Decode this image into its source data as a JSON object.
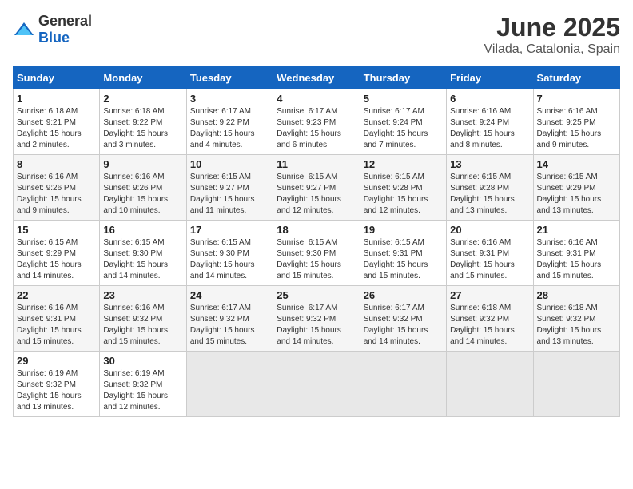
{
  "logo": {
    "general": "General",
    "blue": "Blue"
  },
  "title": "June 2025",
  "subtitle": "Vilada, Catalonia, Spain",
  "days_of_week": [
    "Sunday",
    "Monday",
    "Tuesday",
    "Wednesday",
    "Thursday",
    "Friday",
    "Saturday"
  ],
  "weeks": [
    [
      {
        "day": "1",
        "sunrise": "6:18 AM",
        "sunset": "9:21 PM",
        "daylight": "15 hours and 2 minutes."
      },
      {
        "day": "2",
        "sunrise": "6:18 AM",
        "sunset": "9:22 PM",
        "daylight": "15 hours and 3 minutes."
      },
      {
        "day": "3",
        "sunrise": "6:17 AM",
        "sunset": "9:22 PM",
        "daylight": "15 hours and 4 minutes."
      },
      {
        "day": "4",
        "sunrise": "6:17 AM",
        "sunset": "9:23 PM",
        "daylight": "15 hours and 6 minutes."
      },
      {
        "day": "5",
        "sunrise": "6:17 AM",
        "sunset": "9:24 PM",
        "daylight": "15 hours and 7 minutes."
      },
      {
        "day": "6",
        "sunrise": "6:16 AM",
        "sunset": "9:24 PM",
        "daylight": "15 hours and 8 minutes."
      },
      {
        "day": "7",
        "sunrise": "6:16 AM",
        "sunset": "9:25 PM",
        "daylight": "15 hours and 9 minutes."
      }
    ],
    [
      {
        "day": "8",
        "sunrise": "6:16 AM",
        "sunset": "9:26 PM",
        "daylight": "15 hours and 9 minutes."
      },
      {
        "day": "9",
        "sunrise": "6:16 AM",
        "sunset": "9:26 PM",
        "daylight": "15 hours and 10 minutes."
      },
      {
        "day": "10",
        "sunrise": "6:15 AM",
        "sunset": "9:27 PM",
        "daylight": "15 hours and 11 minutes."
      },
      {
        "day": "11",
        "sunrise": "6:15 AM",
        "sunset": "9:27 PM",
        "daylight": "15 hours and 12 minutes."
      },
      {
        "day": "12",
        "sunrise": "6:15 AM",
        "sunset": "9:28 PM",
        "daylight": "15 hours and 12 minutes."
      },
      {
        "day": "13",
        "sunrise": "6:15 AM",
        "sunset": "9:28 PM",
        "daylight": "15 hours and 13 minutes."
      },
      {
        "day": "14",
        "sunrise": "6:15 AM",
        "sunset": "9:29 PM",
        "daylight": "15 hours and 13 minutes."
      }
    ],
    [
      {
        "day": "15",
        "sunrise": "6:15 AM",
        "sunset": "9:29 PM",
        "daylight": "15 hours and 14 minutes."
      },
      {
        "day": "16",
        "sunrise": "6:15 AM",
        "sunset": "9:30 PM",
        "daylight": "15 hours and 14 minutes."
      },
      {
        "day": "17",
        "sunrise": "6:15 AM",
        "sunset": "9:30 PM",
        "daylight": "15 hours and 14 minutes."
      },
      {
        "day": "18",
        "sunrise": "6:15 AM",
        "sunset": "9:30 PM",
        "daylight": "15 hours and 15 minutes."
      },
      {
        "day": "19",
        "sunrise": "6:15 AM",
        "sunset": "9:31 PM",
        "daylight": "15 hours and 15 minutes."
      },
      {
        "day": "20",
        "sunrise": "6:16 AM",
        "sunset": "9:31 PM",
        "daylight": "15 hours and 15 minutes."
      },
      {
        "day": "21",
        "sunrise": "6:16 AM",
        "sunset": "9:31 PM",
        "daylight": "15 hours and 15 minutes."
      }
    ],
    [
      {
        "day": "22",
        "sunrise": "6:16 AM",
        "sunset": "9:31 PM",
        "daylight": "15 hours and 15 minutes."
      },
      {
        "day": "23",
        "sunrise": "6:16 AM",
        "sunset": "9:32 PM",
        "daylight": "15 hours and 15 minutes."
      },
      {
        "day": "24",
        "sunrise": "6:17 AM",
        "sunset": "9:32 PM",
        "daylight": "15 hours and 15 minutes."
      },
      {
        "day": "25",
        "sunrise": "6:17 AM",
        "sunset": "9:32 PM",
        "daylight": "15 hours and 14 minutes."
      },
      {
        "day": "26",
        "sunrise": "6:17 AM",
        "sunset": "9:32 PM",
        "daylight": "15 hours and 14 minutes."
      },
      {
        "day": "27",
        "sunrise": "6:18 AM",
        "sunset": "9:32 PM",
        "daylight": "15 hours and 14 minutes."
      },
      {
        "day": "28",
        "sunrise": "6:18 AM",
        "sunset": "9:32 PM",
        "daylight": "15 hours and 13 minutes."
      }
    ],
    [
      {
        "day": "29",
        "sunrise": "6:19 AM",
        "sunset": "9:32 PM",
        "daylight": "15 hours and 13 minutes."
      },
      {
        "day": "30",
        "sunrise": "6:19 AM",
        "sunset": "9:32 PM",
        "daylight": "15 hours and 12 minutes."
      },
      null,
      null,
      null,
      null,
      null
    ]
  ],
  "labels": {
    "sunrise": "Sunrise:",
    "sunset": "Sunset:",
    "daylight": "Daylight:"
  }
}
